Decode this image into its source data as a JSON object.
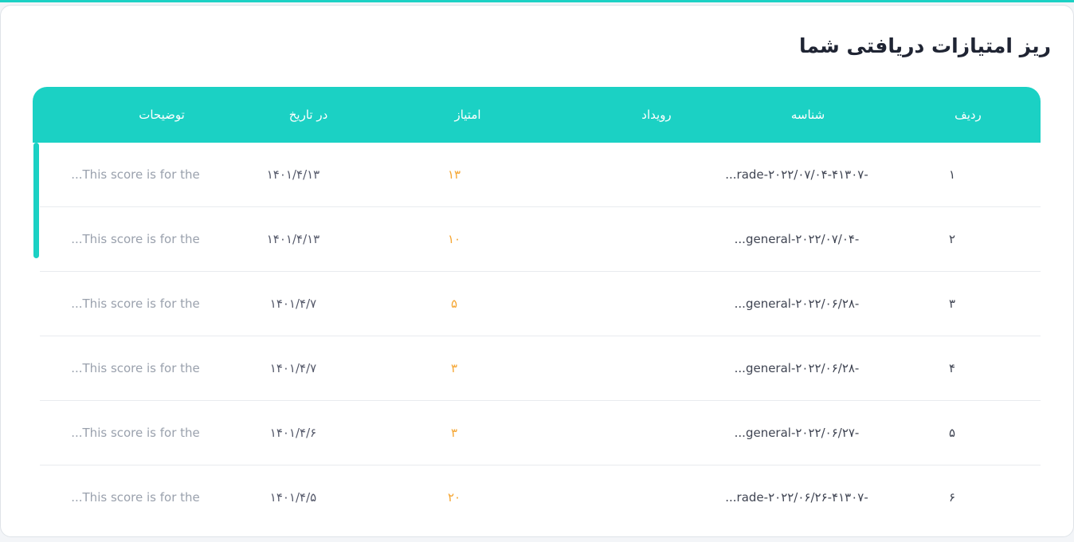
{
  "page": {
    "title": "ریز امتیازات دریافتی شما",
    "accent_color": "#1bd1c4",
    "score_color": "#f5a531"
  },
  "table": {
    "headers": {
      "radif": "ردیف",
      "shenase": "شناسه",
      "rouydad": "رویداد",
      "emtiaz": "امتیاز",
      "date": "در تاریخ",
      "desc": "توضیحات"
    },
    "rows": [
      {
        "radif": "۱",
        "shenase": "...rade-۲۰۲۲/۰۷/۰۴-۴۱۳۰۷-",
        "rouydad": "",
        "emtiaz": "۱۳",
        "date": "۱۴۰۱/۴/۱۳",
        "desc": "...This score is for the"
      },
      {
        "radif": "۲",
        "shenase": "...general-۲۰۲۲/۰۷/۰۴-",
        "rouydad": "",
        "emtiaz": "۱۰",
        "date": "۱۴۰۱/۴/۱۳",
        "desc": "...This score is for the"
      },
      {
        "radif": "۳",
        "shenase": "...general-۲۰۲۲/۰۶/۲۸-",
        "rouydad": "",
        "emtiaz": "۵",
        "date": "۱۴۰۱/۴/۷",
        "desc": "...This score is for the"
      },
      {
        "radif": "۴",
        "shenase": "...general-۲۰۲۲/۰۶/۲۸-",
        "rouydad": "",
        "emtiaz": "۳",
        "date": "۱۴۰۱/۴/۷",
        "desc": "...This score is for the"
      },
      {
        "radif": "۵",
        "shenase": "...general-۲۰۲۲/۰۶/۲۷-",
        "rouydad": "",
        "emtiaz": "۳",
        "date": "۱۴۰۱/۴/۶",
        "desc": "...This score is for the"
      },
      {
        "radif": "۶",
        "shenase": "...rade-۲۰۲۲/۰۶/۲۶-۴۱۳۰۷-",
        "rouydad": "",
        "emtiaz": "۲۰",
        "date": "۱۴۰۱/۴/۵",
        "desc": "...This score is for the"
      }
    ]
  }
}
